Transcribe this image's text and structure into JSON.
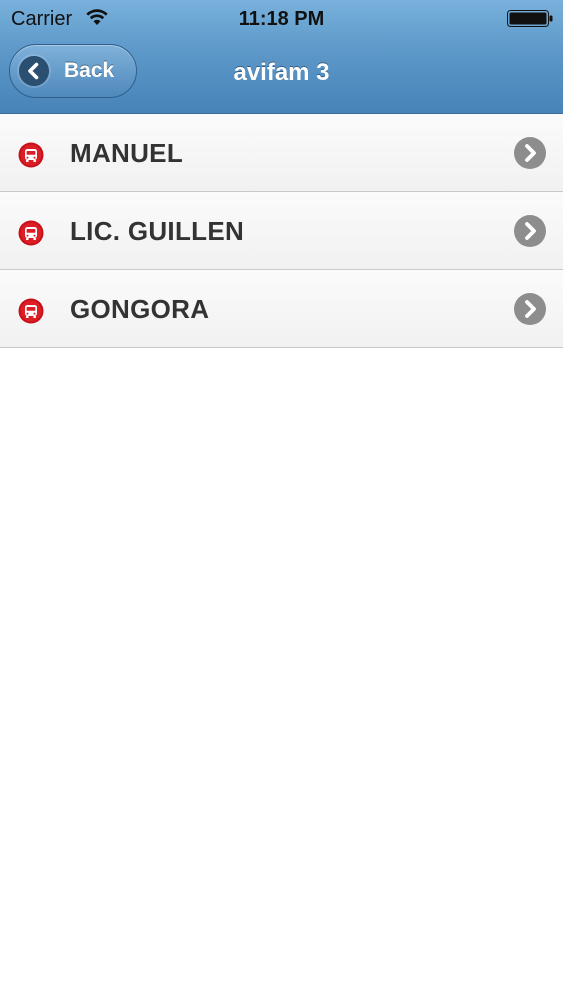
{
  "status_bar": {
    "carrier": "Carrier",
    "time": "11:18 PM",
    "wifi_icon": "wifi-icon",
    "battery_icon": "battery-icon"
  },
  "nav_bar": {
    "back_label": "Back",
    "back_icon": "chevron-left-circle-icon",
    "title": "avifam 3",
    "color": "#5d98c9"
  },
  "list": {
    "items": [
      {
        "label": "MANUEL",
        "icon": "bus-icon",
        "accessory_icon": "chevron-right-circle-icon"
      },
      {
        "label": "LIC. GUILLEN",
        "icon": "bus-icon",
        "accessory_icon": "chevron-right-circle-icon"
      },
      {
        "label": "GONGORA",
        "icon": "bus-icon",
        "accessory_icon": "chevron-right-circle-icon"
      }
    ],
    "icon_color": "#c8101a",
    "chevron_color": "#8d8d8d"
  }
}
